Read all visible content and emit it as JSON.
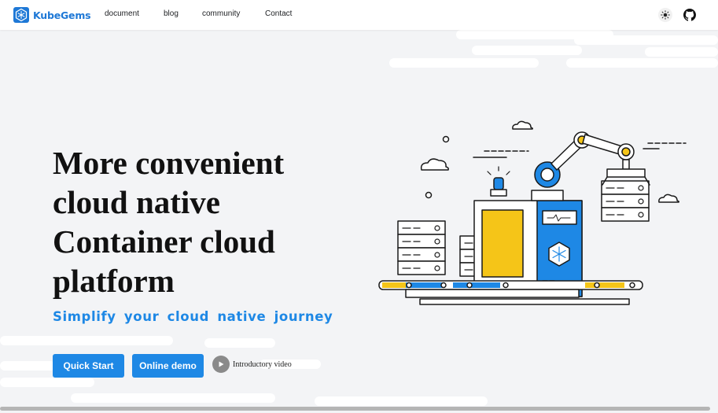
{
  "brand": {
    "name": "KubeGems"
  },
  "nav": {
    "links": [
      {
        "label": "document"
      },
      {
        "label": "blog"
      },
      {
        "label": "community"
      },
      {
        "label": "Contact"
      }
    ],
    "theme_toggle_icon": "sun-icon",
    "github_icon": "github-icon"
  },
  "hero": {
    "title_lines": [
      "More convenient",
      "cloud native",
      "Container cloud",
      "platform"
    ],
    "subtitle": "Simplify your cloud native journey",
    "buttons": {
      "quick_start": "Quick Start",
      "online_demo": "Online demo"
    },
    "video_link": "Introductory video"
  },
  "colors": {
    "accent": "#1e88e5",
    "brand": "#1e78d6",
    "yellow": "#f5c518",
    "background": "#f3f4f6"
  }
}
